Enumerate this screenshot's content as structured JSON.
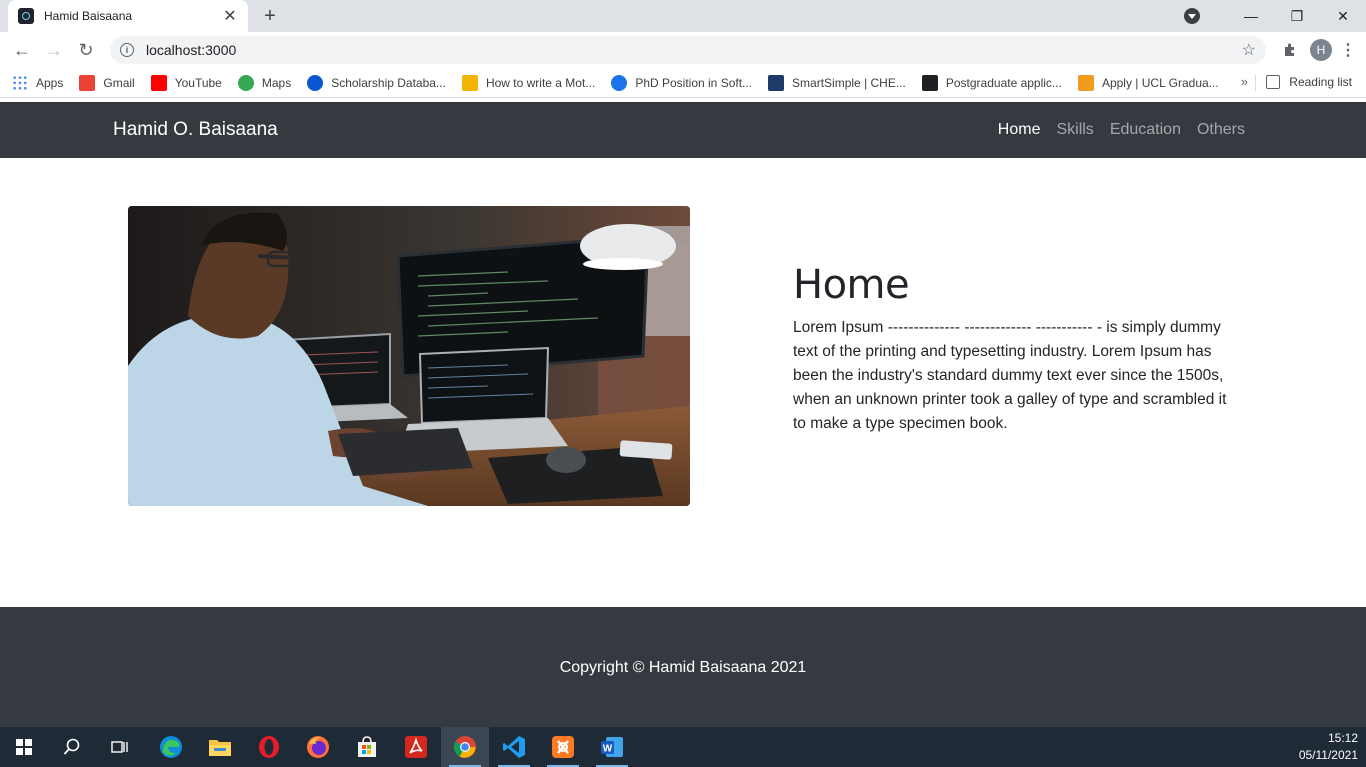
{
  "browser": {
    "tab_title": "Hamid Baisaana",
    "url": "localhost:3000",
    "profile_initial": "H",
    "bookmarks": [
      {
        "label": "Apps",
        "icon": "apps-grid-icon",
        "color": "#4285f4"
      },
      {
        "label": "Gmail",
        "icon": "gmail-icon",
        "color": "#ea4335"
      },
      {
        "label": "YouTube",
        "icon": "youtube-icon",
        "color": "#ff0000"
      },
      {
        "label": "Maps",
        "icon": "maps-icon",
        "color": "#34a853"
      },
      {
        "label": "Scholarship Databa...",
        "icon": "scholarship-icon",
        "color": "#0b57d0"
      },
      {
        "label": "How to write a Mot...",
        "icon": "graduation-cap-icon",
        "color": "#f4b400"
      },
      {
        "label": "PhD Position in Soft...",
        "icon": "compass-icon",
        "color": "#1a73e8"
      },
      {
        "label": "SmartSimple | CHE...",
        "icon": "smartsimple-icon",
        "color": "#1f3a68"
      },
      {
        "label": "Postgraduate applic...",
        "icon": "us-icon",
        "color": "#202124"
      },
      {
        "label": "Apply | UCL Gradua...",
        "icon": "ucl-icon",
        "color": "#f29c1f"
      }
    ],
    "more_label": "»",
    "reading_list": "Reading list"
  },
  "site": {
    "brand": "Hamid O. Baisaana",
    "nav": [
      "Home",
      "Skills",
      "Education",
      "Others"
    ],
    "hero_heading": "Home",
    "hero_paragraph": "Lorem Ipsum -------------- ------------- ----------- - is simply dummy text of the printing and typesetting industry. Lorem Ipsum has been the industry's standard dummy text ever since the 1500s, when an unknown printer took a galley of type and scrambled it to make a type specimen book.",
    "footer": "Copyright © Hamid Baisaana 2021"
  },
  "taskbar": {
    "time": "15:12",
    "date": "05/11/2021"
  },
  "colors": {
    "navbar": "#343a40",
    "footer": "#343a40",
    "taskbar": "#1e2a35"
  }
}
